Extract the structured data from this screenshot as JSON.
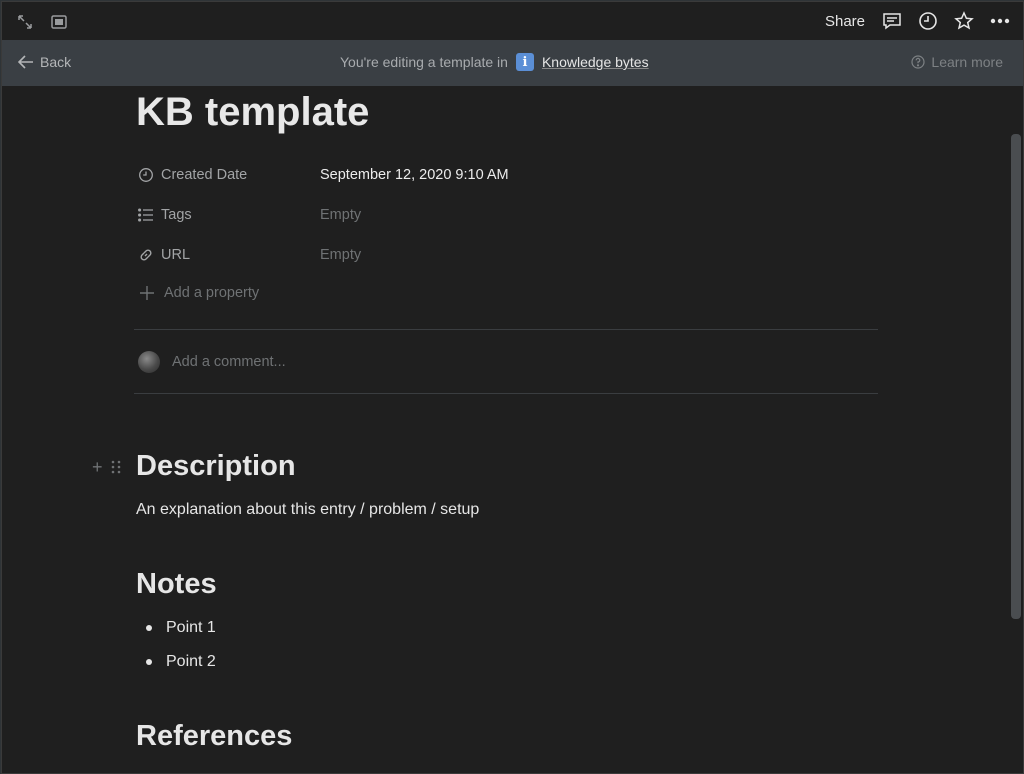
{
  "topbar": {
    "share_label": "Share"
  },
  "banner": {
    "back_label": "Back",
    "editing_text": "You're editing a template in",
    "badge_text": "i",
    "workspace_link": "Knowledge bytes",
    "learn_more": "Learn more"
  },
  "page": {
    "title": "KB template"
  },
  "properties": [
    {
      "name": "Created Date",
      "value": "September 12, 2020 9:10 AM",
      "icon": "clock-icon"
    },
    {
      "name": "Tags",
      "value": "Empty",
      "icon": "list-icon"
    },
    {
      "name": "URL",
      "value": "Empty",
      "icon": "link-icon"
    }
  ],
  "add_property_label": "Add a property",
  "comment_placeholder": "Add a comment...",
  "sections": {
    "description_heading": "Description",
    "description_text": "An explanation about this entry / problem / setup",
    "notes_heading": "Notes",
    "notes_items": [
      "Point 1",
      "Point 2"
    ],
    "references_heading": "References"
  },
  "colors": {
    "background": "#1f1f1f",
    "banner": "#3a3f44",
    "accent": "#5b8fd6"
  }
}
